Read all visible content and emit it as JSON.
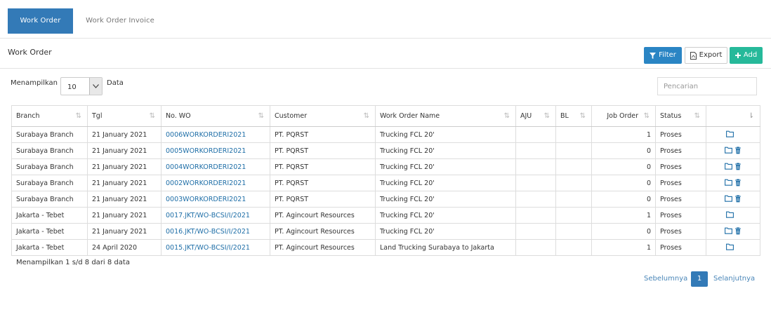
{
  "tabs": [
    {
      "label": "Work Order",
      "active": true
    },
    {
      "label": "Work Order Invoice",
      "active": false
    }
  ],
  "header": {
    "title": "Work Order",
    "buttons": {
      "filter": "Filter",
      "export": "Export",
      "add": "Add"
    }
  },
  "controls": {
    "length_label": "Menampilkan",
    "length_value": "10",
    "length_suffix": "Data",
    "search_placeholder": "Pencarian"
  },
  "table": {
    "columns": [
      "Branch",
      "Tgl",
      "No. WO",
      "Customer",
      "Work Order Name",
      "AJU",
      "BL",
      "Job Order",
      "Status",
      ""
    ],
    "rows": [
      {
        "branch": "Surabaya Branch",
        "tgl": "21 January 2021",
        "no_wo": "0006WORKORDERI2021",
        "customer": "PT. PQRST",
        "name": "Trucking FCL 20'",
        "aju": "",
        "bl": "",
        "job_order": "1",
        "status": "Proses",
        "delete": false
      },
      {
        "branch": "Surabaya Branch",
        "tgl": "21 January 2021",
        "no_wo": "0005WORKORDERI2021",
        "customer": "PT. PQRST",
        "name": "Trucking FCL 20'",
        "aju": "",
        "bl": "",
        "job_order": "0",
        "status": "Proses",
        "delete": true
      },
      {
        "branch": "Surabaya Branch",
        "tgl": "21 January 2021",
        "no_wo": "0004WORKORDERI2021",
        "customer": "PT. PQRST",
        "name": "Trucking FCL 20'",
        "aju": "",
        "bl": "",
        "job_order": "0",
        "status": "Proses",
        "delete": true
      },
      {
        "branch": "Surabaya Branch",
        "tgl": "21 January 2021",
        "no_wo": "0002WORKORDERI2021",
        "customer": "PT. PQRST",
        "name": "Trucking FCL 20'",
        "aju": "",
        "bl": "",
        "job_order": "0",
        "status": "Proses",
        "delete": true
      },
      {
        "branch": "Surabaya Branch",
        "tgl": "21 January 2021",
        "no_wo": "0003WORKORDERI2021",
        "customer": "PT. PQRST",
        "name": "Trucking FCL 20'",
        "aju": "",
        "bl": "",
        "job_order": "0",
        "status": "Proses",
        "delete": true
      },
      {
        "branch": "Jakarta - Tebet",
        "tgl": "21 January 2021",
        "no_wo": "0017.JKT/WO-BCSI/I/2021",
        "customer": "PT. Agincourt Resources",
        "name": "Trucking FCL 20'",
        "aju": "",
        "bl": "",
        "job_order": "1",
        "status": "Proses",
        "delete": false
      },
      {
        "branch": "Jakarta - Tebet",
        "tgl": "21 January 2021",
        "no_wo": "0016.JKT/WO-BCSI/I/2021",
        "customer": "PT. Agincourt Resources",
        "name": "Trucking FCL 20'",
        "aju": "",
        "bl": "",
        "job_order": "0",
        "status": "Proses",
        "delete": true
      },
      {
        "branch": "Jakarta - Tebet",
        "tgl": "24 April 2020",
        "no_wo": "0015.JKT/WO-BCSI/I/2021",
        "customer": "PT. Agincourt Resources",
        "name": "Land Trucking Surabaya to Jakarta",
        "aju": "",
        "bl": "",
        "job_order": "1",
        "status": "Proses",
        "delete": false
      }
    ]
  },
  "footer": {
    "info": "Menampilkan 1 s/d 8 dari 8 data",
    "prev": "Sebelumnya",
    "page": "1",
    "next": "Selanjutnya"
  },
  "colors": {
    "primary": "#337ab7",
    "filter": "#2a85c4",
    "add": "#26b99a",
    "link": "#1e6ea7"
  },
  "icons": [
    "filter-icon",
    "export-icon",
    "plus-icon",
    "chevron-down-icon",
    "sort-icon",
    "folder-icon",
    "trash-icon"
  ]
}
